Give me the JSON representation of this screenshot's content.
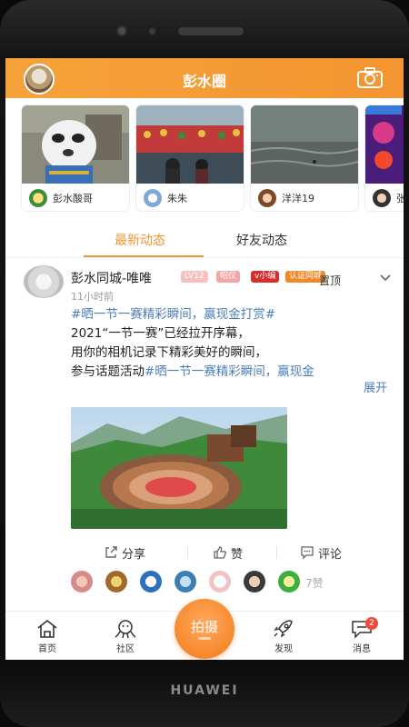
{
  "device": {
    "brand": "HUAWEI"
  },
  "header": {
    "title": "彭水圈",
    "camera_icon": "camera-icon",
    "accent": "#f39530"
  },
  "stories": [
    {
      "name": "彭水酸哥",
      "theme": "panda-statue"
    },
    {
      "name": "朱朱",
      "theme": "dragon-boat-crowd"
    },
    {
      "name": "洋洋19",
      "theme": "river-water"
    },
    {
      "name": "张",
      "theme": "festival-lights"
    }
  ],
  "tabs": [
    {
      "label": "最新动态",
      "active": true
    },
    {
      "label": "好友动态",
      "active": false
    }
  ],
  "post": {
    "author": "彭水同城-唯唯",
    "badges": [
      "LV12",
      "昭仪",
      "v小编",
      "认证同城"
    ],
    "pinned_label": "置顶",
    "time": "11小时前",
    "hashtag_title": "#晒一节一赛精彩瞬间，赢现金打赏#",
    "line2": "2021“一节一赛”已经拉开序幕，",
    "line3": "用你的相机记录下精彩美好的瞬间，",
    "line4_text": "参与话题活动",
    "line4_hashtag": "#晒一节一赛精彩瞬间，赢现金",
    "expand_label": "展开",
    "image_theme": "mountain-village-amphitheater",
    "share_label": "分享",
    "like_label": "赞",
    "comment_label": "评论",
    "like_count_label": "7赞"
  },
  "bottom_nav": {
    "items": [
      {
        "label": "首页",
        "icon": "home-icon"
      },
      {
        "label": "社区",
        "icon": "community-icon"
      },
      {
        "label": "发现",
        "icon": "rocket-icon"
      },
      {
        "label": "消息",
        "icon": "message-icon"
      }
    ],
    "center_label": "拍摄",
    "message_badge": "2"
  }
}
